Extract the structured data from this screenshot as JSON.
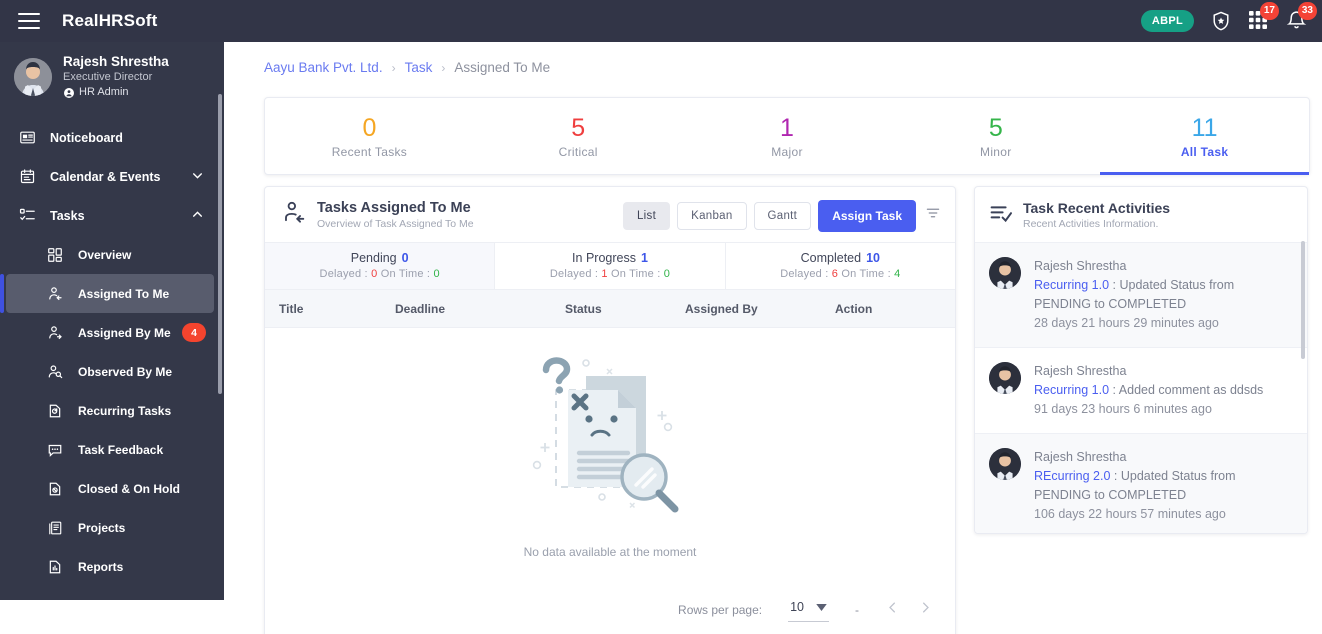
{
  "topbar": {
    "menu_icon": "hamburger-icon",
    "brand": "RealHRSoft",
    "org_pill": "ABPL",
    "shield_icon": "shield-star-icon",
    "apps_icon": "grid-apps-icon",
    "apps_badge": "17",
    "bell_icon": "bell-icon",
    "bell_badge": "33"
  },
  "sidebar": {
    "profile": {
      "name": "Rajesh Shrestha",
      "role": "Executive Director",
      "tag": "HR Admin",
      "tag_icon": "user-shield-icon",
      "avatar": "avatar"
    },
    "items": [
      {
        "label": "Noticeboard",
        "icon": "noticeboard-icon",
        "type": "top"
      },
      {
        "label": "Calendar & Events",
        "icon": "calendar-icon",
        "type": "top",
        "chevron": "chevron-down-icon"
      },
      {
        "label": "Tasks",
        "icon": "tasks-icon",
        "type": "top",
        "chevron": "chevron-up-icon"
      },
      {
        "label": "Overview",
        "icon": "overview-grid-icon",
        "type": "sub"
      },
      {
        "label": "Assigned To Me",
        "icon": "assigned-to-me-icon",
        "type": "sub",
        "active": true
      },
      {
        "label": "Assigned By Me",
        "icon": "assigned-by-me-icon",
        "type": "sub",
        "badge": "4"
      },
      {
        "label": "Observed By Me",
        "icon": "observed-by-me-icon",
        "type": "sub"
      },
      {
        "label": "Recurring Tasks",
        "icon": "recurring-tasks-icon",
        "type": "sub"
      },
      {
        "label": "Task Feedback",
        "icon": "feedback-icon",
        "type": "sub"
      },
      {
        "label": "Closed & On Hold",
        "icon": "closed-on-hold-icon",
        "type": "sub"
      },
      {
        "label": "Projects",
        "icon": "projects-icon",
        "type": "sub"
      },
      {
        "label": "Reports",
        "icon": "reports-icon",
        "type": "sub"
      }
    ]
  },
  "breadcrumb": {
    "org": "Aayu Bank Pvt. Ltd.",
    "section": "Task",
    "current": "Assigned To Me",
    "separator": "›"
  },
  "stats": [
    {
      "value": "0",
      "label": "Recent Tasks",
      "color": "#f5a623"
    },
    {
      "value": "5",
      "label": "Critical",
      "color": "#ef3f3f"
    },
    {
      "value": "1",
      "label": "Major",
      "color": "#b026b0"
    },
    {
      "value": "5",
      "label": "Minor",
      "color": "#35b54a"
    },
    {
      "value": "11",
      "label": "All Task",
      "color": "#3ba7e8",
      "active": true
    }
  ],
  "task_card": {
    "icon": "assigned-to-me-icon",
    "title": "Tasks Assigned To Me",
    "subtitle": "Overview of Task Assigned To Me",
    "views": [
      {
        "label": "List",
        "active": true
      },
      {
        "label": "Kanban",
        "active": false
      },
      {
        "label": "Gantt",
        "active": false
      }
    ],
    "assign_button": "Assign Task",
    "filter_icon": "filter-icon",
    "status_groups": [
      {
        "title": "Pending",
        "count": "0",
        "delayed_label": "Delayed :",
        "delayed": "0",
        "ontime_label": "On Time :",
        "ontime": "0",
        "selected": true
      },
      {
        "title": "In Progress",
        "count": "1",
        "delayed_label": "Delayed :",
        "delayed": "1",
        "ontime_label": "On Time :",
        "ontime": "0"
      },
      {
        "title": "Completed",
        "count": "10",
        "delayed_label": "Delayed :",
        "delayed": "6",
        "ontime_label": "On Time :",
        "ontime": "4"
      }
    ],
    "columns": [
      "Title",
      "Deadline",
      "Status",
      "Assigned By",
      "Action"
    ],
    "empty_text": "No data available at the moment",
    "empty_illustration": "no-data-illustration",
    "pagination": {
      "rows_label": "Rows per page:",
      "rows_value": "10",
      "range": "-",
      "prev_icon": "chevron-left-icon",
      "next_icon": "chevron-right-icon",
      "dropdown_icon": "caret-down-icon"
    }
  },
  "activities": {
    "icon": "activity-list-check-icon",
    "title": "Task Recent Activities",
    "subtitle": "Recent Activities Information.",
    "items": [
      {
        "user": "Rajesh Shrestha",
        "link": "Recurring 1.0",
        "text": " : Updated Status from PENDING to COMPLETED",
        "time": "28 days 21 hours 29 minutes ago",
        "highlight": true
      },
      {
        "user": "Rajesh Shrestha",
        "link": "Recurring 1.0",
        "text": " : Added comment as ddsds",
        "time": "91 days 23 hours 6 minutes ago"
      },
      {
        "user": "Rajesh Shrestha",
        "link": "REcurring 2.0",
        "text": " : Updated Status from PENDING to COMPLETED",
        "time": "106 days 22 hours 57 minutes ago",
        "highlight": true
      }
    ]
  }
}
